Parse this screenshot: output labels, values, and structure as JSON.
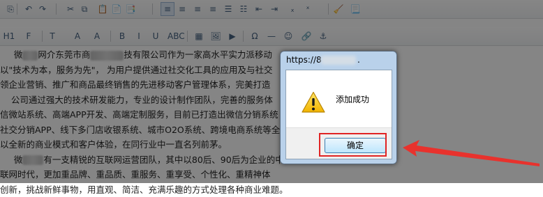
{
  "toolbar1": {
    "buttons": [
      {
        "glyph": "⎘",
        "icon": "copy-format-icon"
      },
      {
        "glyph": "↶",
        "icon": "undo-icon"
      },
      {
        "glyph": "↷",
        "icon": "redo-icon"
      },
      {
        "glyph": "✂",
        "icon": "cut-icon"
      },
      {
        "glyph": "⧉",
        "icon": "copy-icon"
      },
      {
        "glyph": "📋",
        "icon": "paste-icon"
      },
      {
        "glyph": "📄",
        "icon": "paste-text-icon"
      },
      {
        "glyph": "📑",
        "icon": "paste-word-icon"
      },
      {
        "glyph": "≡",
        "icon": "align-left-icon"
      },
      {
        "glyph": "≡",
        "icon": "align-center-icon"
      },
      {
        "glyph": "≡",
        "icon": "align-right-icon"
      },
      {
        "glyph": "≡",
        "icon": "justify-icon"
      },
      {
        "glyph": "☰",
        "icon": "ordered-list-icon"
      },
      {
        "glyph": "☷",
        "icon": "unordered-list-icon"
      },
      {
        "glyph": "⇤",
        "icon": "outdent-icon"
      },
      {
        "glyph": "⇥",
        "icon": "indent-icon"
      },
      {
        "glyph": "ₓ",
        "icon": "subscript-icon"
      },
      {
        "glyph": "ˣ",
        "icon": "superscript-icon"
      },
      {
        "glyph": "🧹",
        "icon": "clear-format-icon"
      },
      {
        "glyph": "📃",
        "icon": "select-all-icon"
      }
    ]
  },
  "toolbar2": {
    "buttons": [
      {
        "glyph": "H1",
        "icon": "heading-icon"
      },
      {
        "glyph": "F",
        "icon": "font-family-icon"
      },
      {
        "glyph": "T",
        "icon": "font-size-icon"
      },
      {
        "glyph": "A",
        "icon": "font-color-icon"
      },
      {
        "glyph": "A",
        "icon": "highlight-color-icon"
      },
      {
        "glyph": "B",
        "icon": "bold-icon"
      },
      {
        "glyph": "I",
        "icon": "italic-icon"
      },
      {
        "glyph": "U",
        "icon": "underline-icon"
      },
      {
        "glyph": "ABC",
        "icon": "strikethrough-icon"
      },
      {
        "glyph": "▦",
        "icon": "table-icon"
      },
      {
        "glyph": "🖼",
        "icon": "image-icon"
      },
      {
        "glyph": "▶",
        "icon": "media-icon"
      },
      {
        "glyph": "Ω",
        "icon": "special-char-icon"
      },
      {
        "glyph": "—",
        "icon": "horizontal-rule-icon"
      },
      {
        "glyph": "☺",
        "icon": "emoticon-icon"
      },
      {
        "glyph": "🔗",
        "icon": "link-icon"
      },
      {
        "glyph": "⚓",
        "icon": "anchor-icon"
      }
    ]
  },
  "content": {
    "para1": {
      "a": "微",
      "b": "网介东莞市商",
      "c": "技有限公司作为一家高水平实力派移动"
    },
    "line2": "以\"技术为本，服务为先\"， 为用户提供通过社交化工具的应用及与社交",
    "line3": "领企业营销、推广和商品最终销售的先进移动客户管理体系，完美打造",
    "line4": "    公司通过强大的技术研发能力，专业的设计制作团队，完善的服务体",
    "line5": "信微站系统、高端APP开发、高端定制服务，目前已打造出微信分销系统",
    "line6": "社交分销APP、线下多门店收银系统、城市O2O系统、跨境电商系统等全",
    "line7": "以全新的商业模式和客户体验，在同行业中一直名列前茅。",
    "para8": {
      "a": "微",
      "b": "有一支精锐的互联网运营团队，其中以80后、90后为企业的中"
    },
    "line9": "联网时代，更加重品牌、重品质、重服务、重享受、个性化、重精神体",
    "line10": "创新，挑战新鲜事物，用直观、简洁、充满乐趣的方式处理各种商业难题。"
  },
  "dialog": {
    "title_prefix": "https://8",
    "title_suffix": ".",
    "message": "添加成功",
    "ok_label": "确定"
  },
  "colors": {
    "highlight_box": "#e02424",
    "arrow": "#e8322d",
    "dialog_frame": "#b9d1ea"
  }
}
